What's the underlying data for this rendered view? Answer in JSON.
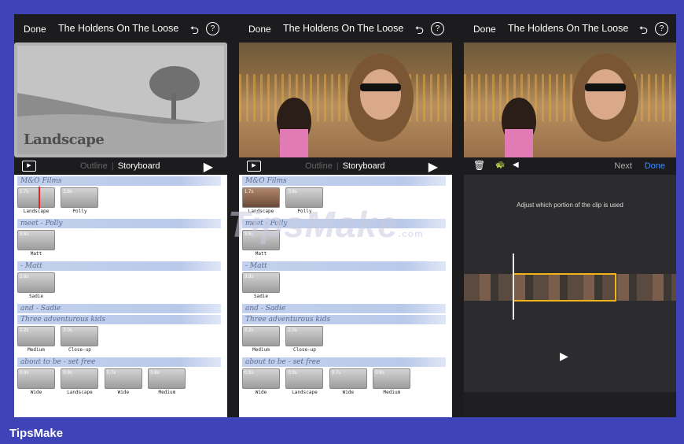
{
  "brand": "TipsMake",
  "watermark": {
    "main": "TipsMake",
    "suffix": ".com"
  },
  "topbar": {
    "done": "Done",
    "title": "The Holdens On The Loose",
    "undo_icon": "undo-icon",
    "help_icon": "help-icon"
  },
  "panel1": {
    "preview_label": "Landscape"
  },
  "toolbar": {
    "outline": "Outline",
    "storyboard": "Storyboard",
    "separator": "|"
  },
  "storyboard": {
    "headers": [
      "M&O Films",
      "meet - Polly",
      "- Matt",
      "and - Sadie",
      "Three adventurous kids",
      "about to be - set free"
    ],
    "rows": [
      [
        {
          "dur": "1.7s",
          "cap": "Landscape"
        },
        {
          "dur": "3.8s",
          "cap": "Polly"
        }
      ],
      [
        {
          "dur": "3.8s",
          "cap": "Matt"
        }
      ],
      [
        {
          "dur": "3.8s",
          "cap": "Sadie"
        }
      ],
      [
        {
          "dur": "2.2s",
          "cap": "Medium"
        },
        {
          "dur": "2.0s",
          "cap": "Close-up"
        }
      ],
      [
        {
          "dur": "0.9s",
          "cap": "Wide"
        },
        {
          "dur": "0.9s",
          "cap": "Landscape"
        },
        {
          "dur": "0.7s",
          "cap": "Wide"
        },
        {
          "dur": "0.8s",
          "cap": "Medium"
        }
      ]
    ]
  },
  "edit": {
    "hint": "Adjust which portion of the clip is used",
    "next": "Next",
    "done": "Done"
  }
}
